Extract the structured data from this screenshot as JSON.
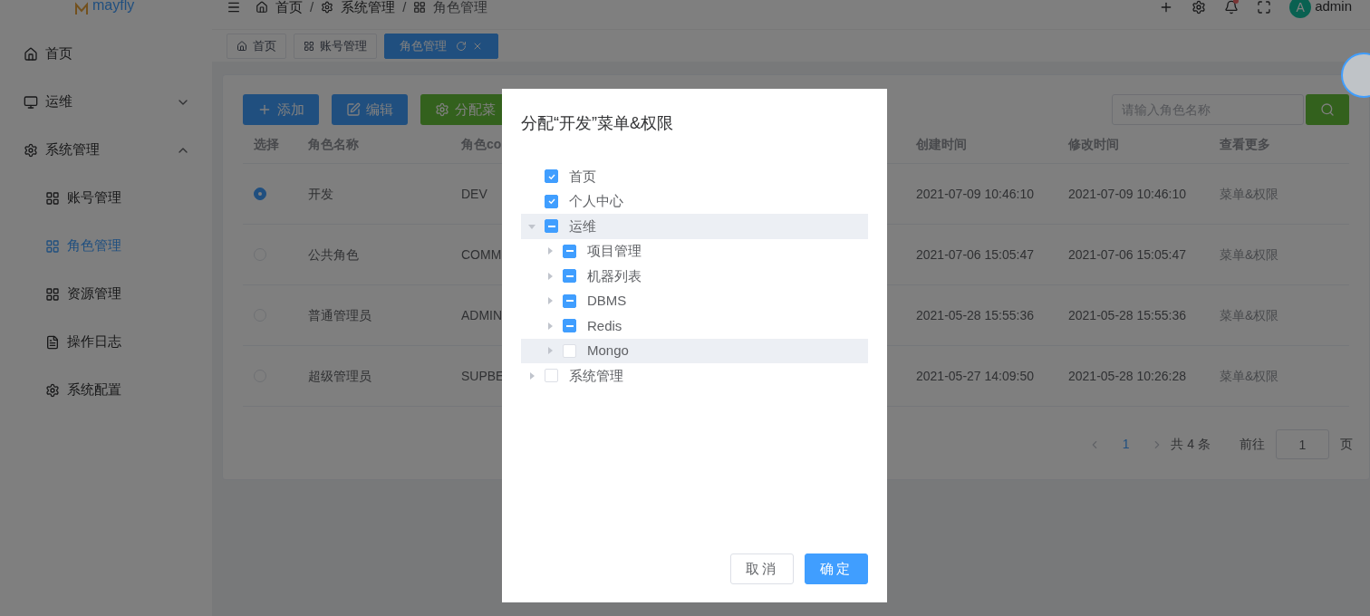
{
  "logo": {
    "text": "mayfly"
  },
  "sidebar": {
    "items": [
      {
        "label": "首页",
        "kind": "home",
        "selected": false
      },
      {
        "label": "运维",
        "kind": "monitor",
        "selected": false,
        "expanded": false
      },
      {
        "label": "系统管理",
        "kind": "gear",
        "selected": false,
        "expanded": true,
        "children": [
          {
            "label": "账号管理",
            "kind": "grid",
            "selected": false
          },
          {
            "label": "角色管理",
            "kind": "grid",
            "selected": true
          },
          {
            "label": "资源管理",
            "kind": "grid",
            "selected": false
          },
          {
            "label": "操作日志",
            "kind": "doc",
            "selected": false
          },
          {
            "label": "系统配置",
            "kind": "gear",
            "selected": false
          }
        ]
      }
    ]
  },
  "breadcrumb": [
    {
      "label": "首页",
      "kind": "home"
    },
    {
      "separator": "/",
      "label": "系统管理",
      "kind": "gear"
    },
    {
      "separator": "/",
      "label": "角色管理",
      "kind": "grid"
    }
  ],
  "header": {
    "user": {
      "avatar": "A",
      "name": "admin"
    },
    "notification_dot": true
  },
  "tabs": [
    {
      "label": "首页",
      "kind": "home",
      "selected": false
    },
    {
      "label": "账号管理",
      "kind": "grid",
      "selected": false
    },
    {
      "label": "角色管理",
      "selected": true
    }
  ],
  "toolbar": {
    "buttons": [
      {
        "label": "添加",
        "kind": "primary"
      },
      {
        "label": "编辑",
        "kind": "primary"
      },
      {
        "label": "分配菜",
        "kind": "success"
      }
    ],
    "search": {
      "placeholder": "请输入角色名称"
    }
  },
  "table": {
    "columns": [
      "选择",
      "角色名称",
      "角色co",
      "创建时间",
      "修改时间",
      "查看更多"
    ],
    "rows": [
      {
        "selected": true,
        "name": "开发",
        "code": "DEV",
        "created": "2021-07-09 10:46:10",
        "modified": "2021-07-09 10:46:10",
        "more": "菜单&权限"
      },
      {
        "selected": false,
        "name": "公共角色",
        "code": "COMM",
        "created": "2021-07-06 15:05:47",
        "modified": "2021-07-06 15:05:47",
        "more": "菜单&权限"
      },
      {
        "selected": false,
        "name": "普通管理员",
        "code": "ADMIN",
        "created": "2021-05-28 15:55:36",
        "modified": "2021-05-28 15:55:36",
        "more": "菜单&权限"
      },
      {
        "selected": false,
        "name": "超级管理员",
        "code": "SUPBE",
        "created": "2021-05-27 14:09:50",
        "modified": "2021-05-28 10:26:28",
        "more": "菜单&权限"
      }
    ]
  },
  "pagination": {
    "pages": [
      {
        "label": "1",
        "selected": true
      }
    ],
    "total": "共 4 条",
    "goto": "前往",
    "page_input": "1",
    "page_suffix": "页"
  },
  "dialog": {
    "title": "分配“开发”菜单&权限",
    "tree": [
      {
        "label": "首页",
        "checked": true,
        "indeterminate": false,
        "highlighted": false
      },
      {
        "label": "个人中心",
        "checked": true,
        "indeterminate": false,
        "highlighted": false
      },
      {
        "label": "运维",
        "checked": false,
        "indeterminate": true,
        "highlighted": true,
        "expanded": true,
        "children": [
          {
            "label": "项目管理",
            "checked": false,
            "indeterminate": true,
            "highlighted": false,
            "expanded": false
          },
          {
            "label": "机器列表",
            "checked": false,
            "indeterminate": true,
            "highlighted": false,
            "expanded": false
          },
          {
            "label": "DBMS",
            "checked": false,
            "indeterminate": true,
            "highlighted": false,
            "expanded": false
          },
          {
            "label": "Redis",
            "checked": false,
            "indeterminate": true,
            "highlighted": false,
            "expanded": false
          },
          {
            "label": "Mongo",
            "checked": false,
            "indeterminate": false,
            "highlighted": true,
            "expanded": false
          }
        ]
      },
      {
        "label": "系统管理",
        "checked": false,
        "indeterminate": false,
        "highlighted": false,
        "expanded": false
      }
    ],
    "buttons": [
      {
        "label": "取消",
        "kind": "default"
      },
      {
        "label": "确定",
        "kind": "primary"
      }
    ]
  }
}
